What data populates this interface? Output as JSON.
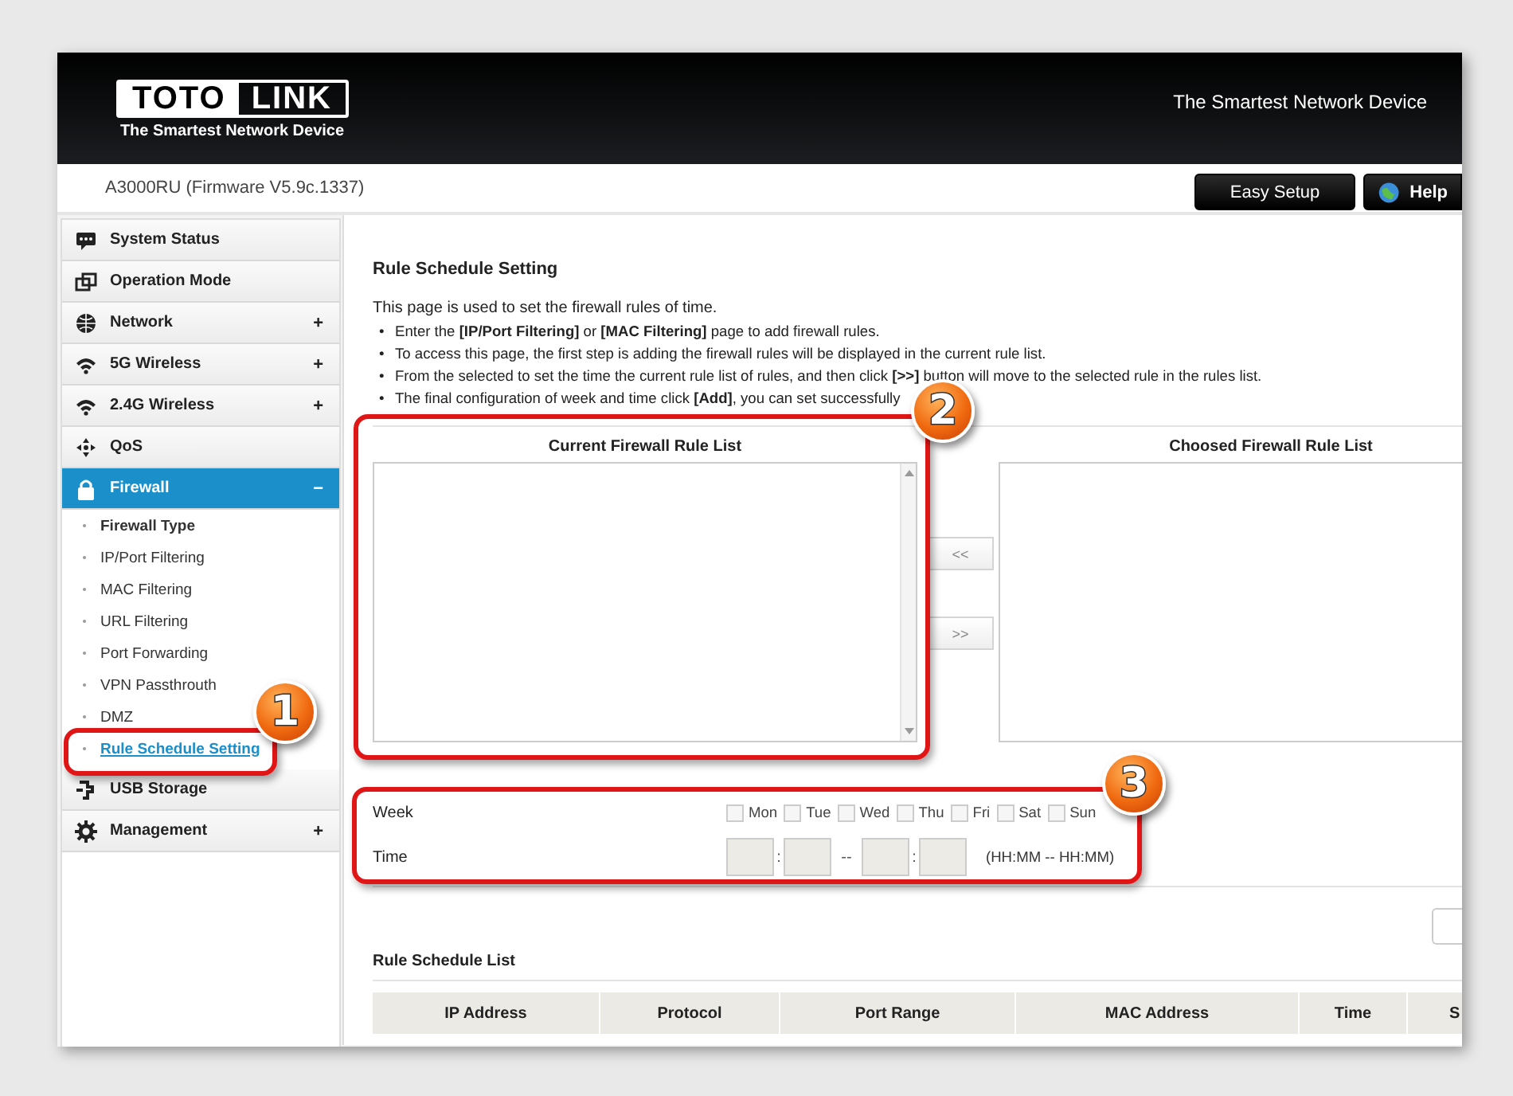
{
  "header": {
    "logo_left": "TOTO",
    "logo_right": "LINK",
    "logo_tagline": "The Smartest Network Device",
    "tagline": "The Smartest Network Device"
  },
  "subheader": {
    "model": "A3000RU (Firmware V5.9c.1337)",
    "buttons": [
      {
        "label": "Easy Setup",
        "kind": "text"
      },
      {
        "label": "Help",
        "kind": "help"
      }
    ]
  },
  "sidebar": {
    "items": [
      {
        "label": "System Status",
        "selected": false
      },
      {
        "label": "Operation Mode",
        "selected": false
      },
      {
        "label": "Network",
        "toggle": "+",
        "selected": false
      },
      {
        "label": "5G Wireless",
        "toggle": "+",
        "selected": false
      },
      {
        "label": "2.4G Wireless",
        "toggle": "+",
        "selected": false
      },
      {
        "label": "QoS",
        "selected": false
      },
      {
        "label": "Firewall",
        "toggle": "−",
        "selected": true,
        "expanded": true,
        "children": [
          {
            "label": "Firewall Type",
            "selected": false
          },
          {
            "label": "IP/Port Filtering",
            "selected": false
          },
          {
            "label": "MAC Filtering",
            "selected": false
          },
          {
            "label": "URL Filtering",
            "selected": false
          },
          {
            "label": "Port Forwarding",
            "selected": false
          },
          {
            "label": "VPN Passthrouth",
            "selected": false
          },
          {
            "label": "DMZ",
            "selected": false
          },
          {
            "label": "Rule Schedule Setting",
            "selected": true
          }
        ]
      },
      {
        "label": "USB Storage",
        "selected": false
      },
      {
        "label": "Management",
        "toggle": "+",
        "selected": false
      }
    ]
  },
  "content": {
    "title": "Rule Schedule Setting",
    "intro": "This page is used to set the firewall rules of time.",
    "bullets": [
      {
        "marker": "•",
        "text": "Enter the **[IP/Port Filtering]** or **[MAC Filtering]** page to add firewall rules."
      },
      {
        "marker": "•",
        "text": "To access this page, the first step is adding the firewall rules will be displayed in the current rule list."
      },
      {
        "marker": "•",
        "text": "From the selected to set the time the current rule list of rules, and then click **[>>]** button will move to the selected rule in the rules list."
      },
      {
        "marker": "•",
        "text": "The final configuration of week and time click **[Add]**, you can set successfully"
      }
    ],
    "current_list": {
      "title": "Current Firewall Rule List"
    },
    "move_buttons": [
      "<<",
      ">>"
    ],
    "chosen_list": {
      "title": "Choosed Firewall Rule List"
    },
    "week": {
      "label": "Week",
      "days": [
        {
          "label": "Mon",
          "checked": false
        },
        {
          "label": "Tue",
          "checked": false
        },
        {
          "label": "Wed",
          "checked": false
        },
        {
          "label": "Thu",
          "checked": false
        },
        {
          "label": "Fri",
          "checked": false
        },
        {
          "label": "Sat",
          "checked": false
        },
        {
          "label": "Sun",
          "checked": false
        }
      ]
    },
    "time": {
      "label": "Time",
      "fields": [
        {
          "disabled": true
        },
        {
          "disabled": true
        },
        {
          "disabled": true
        },
        {
          "disabled": true
        }
      ],
      "separators": [
        ":",
        "--",
        ":"
      ],
      "hint": "(HH:MM -- HH:MM)"
    },
    "schedule_list": {
      "title": "Rule Schedule List",
      "columns": [
        "IP Address",
        "Protocol",
        "Port Range",
        "MAC Address",
        "Time",
        "S"
      ]
    }
  },
  "annotations": [
    {
      "label": "1"
    },
    {
      "label": "2"
    },
    {
      "label": "3"
    }
  ]
}
